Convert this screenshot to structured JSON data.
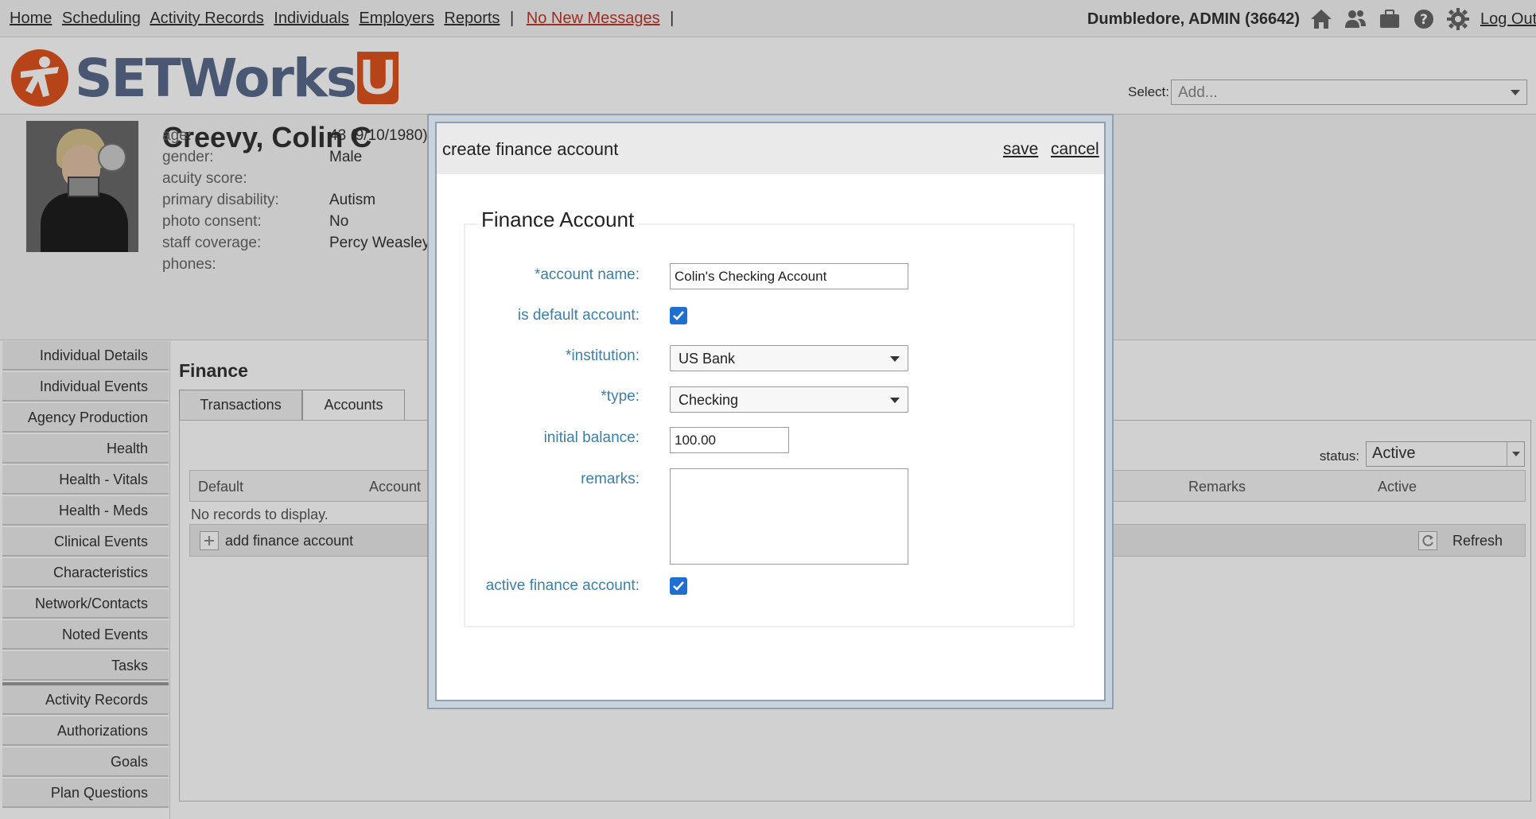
{
  "nav": {
    "links": [
      "Home",
      "Scheduling",
      "Activity Records",
      "Individuals",
      "Employers",
      "Reports"
    ],
    "separator": "|",
    "messages": "No New Messages"
  },
  "user": {
    "name": "Dumbledore, ADMIN  (36642)",
    "logout": "Log Out"
  },
  "logo": {
    "text": "SETWorks",
    "u": "U"
  },
  "header_select": {
    "label": "Select:",
    "value": "Add..."
  },
  "individual": {
    "name": "Creevy, Colin C",
    "fields": [
      {
        "label": "age:",
        "value": "43 (9/10/1980)"
      },
      {
        "label": "gender:",
        "value": "Male"
      },
      {
        "label": "acuity score:",
        "value": ""
      },
      {
        "label": "primary disability:",
        "value": "Autism"
      },
      {
        "label": "photo consent:",
        "value": "No"
      },
      {
        "label": "staff coverage:",
        "value": "Percy Weasley E"
      },
      {
        "label": "phones:",
        "value": ""
      }
    ]
  },
  "sidebar": {
    "items": [
      "Individual Details",
      "Individual Events",
      "Agency Production",
      "Health",
      "Health - Vitals",
      "Health - Meds",
      "Clinical Events",
      "Characteristics",
      "Network/Contacts",
      "Noted Events",
      "Tasks"
    ],
    "items2": [
      "Activity Records",
      "Authorizations",
      "Goals",
      "Plan Questions"
    ]
  },
  "finance": {
    "title": "Finance",
    "tabs": [
      "Transactions",
      "Accounts"
    ],
    "status_label": "status:",
    "status_value": "Active",
    "columns": [
      "Default",
      "Account",
      "Remarks",
      "Active"
    ],
    "empty": "No records to display.",
    "add_label": "add finance account",
    "refresh_label": "Refresh"
  },
  "modal": {
    "title": "create finance account",
    "save": "save",
    "cancel": "cancel",
    "legend": "Finance Account",
    "fields": {
      "account_name_label": "*account name:",
      "account_name_value": "Colin's Checking Account",
      "is_default_label": "is default account:",
      "is_default_checked": true,
      "institution_label": "*institution:",
      "institution_value": "US Bank",
      "type_label": "*type:",
      "type_value": "Checking",
      "initial_balance_label": "initial balance:",
      "initial_balance_value": "100.00",
      "remarks_label": "remarks:",
      "remarks_value": "",
      "active_label": "active finance account:",
      "active_checked": true
    }
  },
  "colors": {
    "label_blue": "#3d7fa8",
    "checkbox_blue": "#1f6fd1",
    "message_red": "#c0392b",
    "logo_orange": "#e0541f",
    "logo_slate": "#5a6b8c"
  }
}
